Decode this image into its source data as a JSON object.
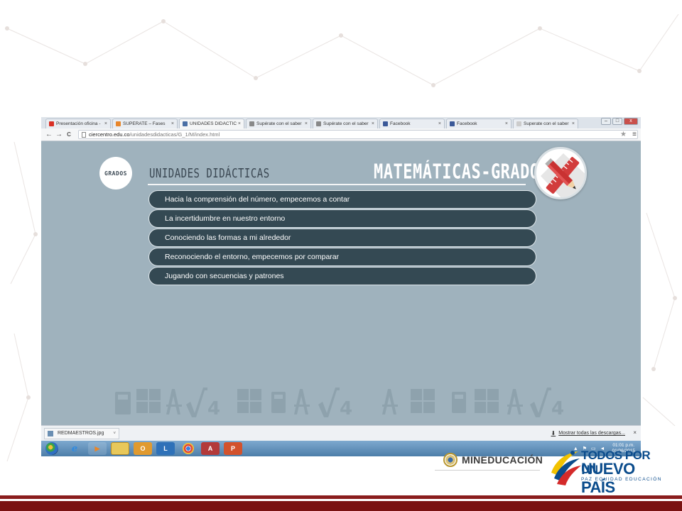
{
  "browser": {
    "tabs": [
      {
        "label": "Presentación oficina - ",
        "icon": "gmail-icon",
        "color": "#d93025",
        "active": false
      },
      {
        "label": "SUPERATE – Fases",
        "icon": "superate-icon",
        "color": "#e8862a",
        "active": false
      },
      {
        "label": "UNIDADES DIDÁCTICAS",
        "icon": "grid-icon",
        "color": "#4a6fa5",
        "active": true
      },
      {
        "label": "Supérate con el saber",
        "icon": "pen-icon",
        "color": "#888888",
        "active": false
      },
      {
        "label": "Supérate con el saber",
        "icon": "pen-icon",
        "color": "#888888",
        "active": false
      },
      {
        "label": "Facebook",
        "icon": "facebook-icon",
        "color": "#3b5998",
        "active": false
      },
      {
        "label": "Facebook",
        "icon": "facebook-icon",
        "color": "#3b5998",
        "active": false
      },
      {
        "label": "Superate con el saber",
        "icon": "page-icon",
        "color": "#cccccc",
        "active": false
      }
    ],
    "tab_close": "×",
    "window_controls": {
      "minimize": "–",
      "maximize": "□",
      "close": "x"
    },
    "url": {
      "host": "ciercentro.edu.co",
      "path": "/unidadesdidacticas/G_1/M/index.html"
    },
    "nav": {
      "back": "←",
      "forward": "→",
      "reload": "C",
      "star": "★",
      "menu": "≡"
    }
  },
  "page": {
    "grados_label": "GRADOS",
    "section_title": "UNIDADES DIDÁCTICAS",
    "subject_title": "MATEMÁTICAS-GRADO 1",
    "units": [
      "Hacia la comprensión del número, empecemos a contar",
      "La incertidumbre en nuestro entorno",
      "Conociendo las formas a mi alrededor",
      "Reconociendo el entorno, empecemos por comparar",
      "Jugando con secuencias y patrones"
    ]
  },
  "downloads": {
    "file": "REDMAESTROS.jpg",
    "caret": "˅",
    "show_all": "Mostrar todas las descargas...",
    "download_glyph": "⬇",
    "close": "×"
  },
  "taskbar": {
    "apps": [
      "ie",
      "media",
      "folder",
      "outlook",
      "lync",
      "chrome",
      "access",
      "powerpoint"
    ],
    "outlook_label": "O",
    "lync_label": "L",
    "access_label": "A",
    "ppt_label": "P",
    "ie_label": "e",
    "media_label": "▶",
    "tray_icons": "▲ ⚑ ▭ ◄",
    "time": "01:01 p.m.",
    "date": "01/06/2015"
  },
  "logos": {
    "mineducacion": "MINEDUCACIÓN",
    "pais_line1": "TODOS POR UN",
    "pais_line2": "NUEVO PAÍS",
    "pais_line3": "PAZ  EQUIDAD  EDUCACIÓN"
  },
  "colors": {
    "content_bg": "#9fb2bd",
    "unit_bg": "#344953",
    "footer": "#7a1212",
    "logo_blue": "#0b4c8c"
  }
}
